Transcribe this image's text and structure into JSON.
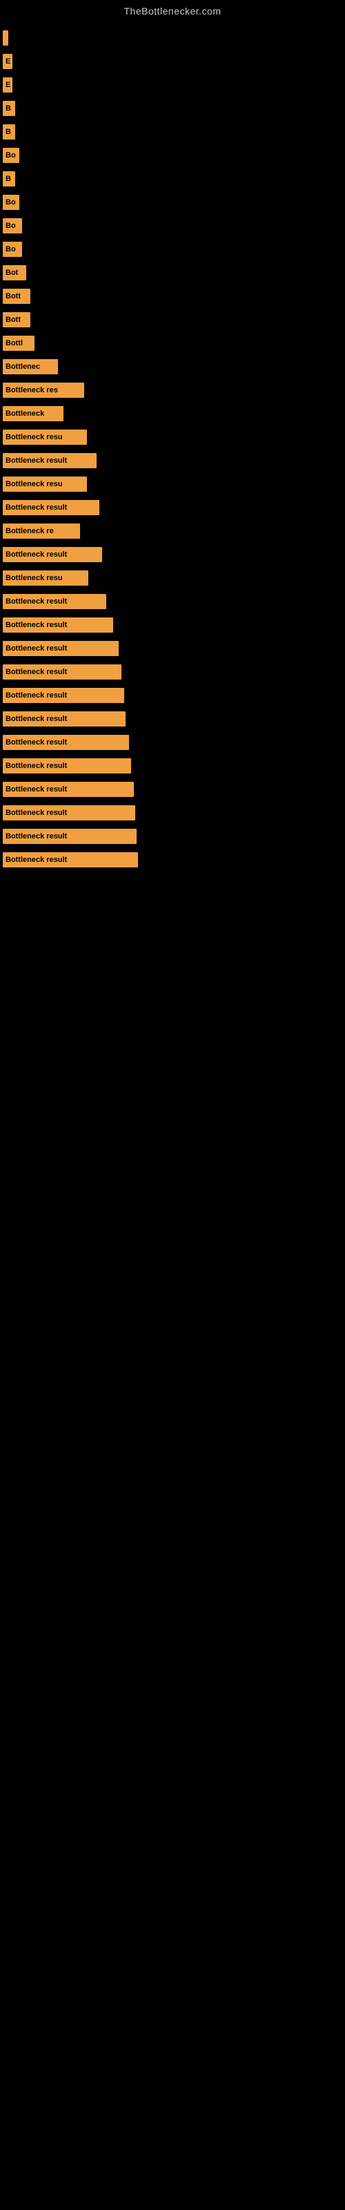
{
  "site_title": "TheBottlenecker.com",
  "bars": [
    {
      "label": "",
      "width": 8,
      "text": ""
    },
    {
      "label": "E",
      "width": 14,
      "text": "E"
    },
    {
      "label": "E",
      "width": 14,
      "text": "E"
    },
    {
      "label": "B",
      "width": 18,
      "text": "B"
    },
    {
      "label": "B",
      "width": 18,
      "text": "B"
    },
    {
      "label": "Bo",
      "width": 24,
      "text": "Bo"
    },
    {
      "label": "B",
      "width": 18,
      "text": "B"
    },
    {
      "label": "Bo",
      "width": 24,
      "text": "Bo"
    },
    {
      "label": "Bo",
      "width": 28,
      "text": "Bo"
    },
    {
      "label": "Bo",
      "width": 28,
      "text": "Bo"
    },
    {
      "label": "Bot",
      "width": 34,
      "text": "Bot"
    },
    {
      "label": "Bott",
      "width": 40,
      "text": "Bott"
    },
    {
      "label": "Bott",
      "width": 40,
      "text": "Bott"
    },
    {
      "label": "Bottl",
      "width": 46,
      "text": "Bottl"
    },
    {
      "label": "Bottlenec",
      "width": 80,
      "text": "Bottlenec"
    },
    {
      "label": "Bottleneck res",
      "width": 118,
      "text": "Bottleneck res"
    },
    {
      "label": "Bottleneck",
      "width": 88,
      "text": "Bottleneck"
    },
    {
      "label": "Bottleneck resu",
      "width": 122,
      "text": "Bottleneck resu"
    },
    {
      "label": "Bottleneck result",
      "width": 136,
      "text": "Bottleneck result"
    },
    {
      "label": "Bottleneck resu",
      "width": 122,
      "text": "Bottleneck resu"
    },
    {
      "label": "Bottleneck result",
      "width": 140,
      "text": "Bottleneck result"
    },
    {
      "label": "Bottleneck re",
      "width": 112,
      "text": "Bottleneck re"
    },
    {
      "label": "Bottleneck result",
      "width": 144,
      "text": "Bottleneck result"
    },
    {
      "label": "Bottleneck resu",
      "width": 124,
      "text": "Bottleneck resu"
    },
    {
      "label": "Bottleneck result",
      "width": 150,
      "text": "Bottleneck result"
    },
    {
      "label": "Bottleneck result",
      "width": 160,
      "text": "Bottleneck result"
    },
    {
      "label": "Bottleneck result",
      "width": 168,
      "text": "Bottleneck result"
    },
    {
      "label": "Bottleneck result",
      "width": 172,
      "text": "Bottleneck result"
    },
    {
      "label": "Bottleneck result",
      "width": 176,
      "text": "Bottleneck result"
    },
    {
      "label": "Bottleneck result",
      "width": 178,
      "text": "Bottleneck result"
    },
    {
      "label": "Bottleneck result",
      "width": 183,
      "text": "Bottleneck result"
    },
    {
      "label": "Bottleneck result",
      "width": 186,
      "text": "Bottleneck result"
    },
    {
      "label": "Bottleneck result",
      "width": 190,
      "text": "Bottleneck result"
    },
    {
      "label": "Bottleneck result",
      "width": 192,
      "text": "Bottleneck result"
    },
    {
      "label": "Bottleneck result",
      "width": 194,
      "text": "Bottleneck result"
    },
    {
      "label": "Bottleneck result",
      "width": 196,
      "text": "Bottleneck result"
    }
  ]
}
